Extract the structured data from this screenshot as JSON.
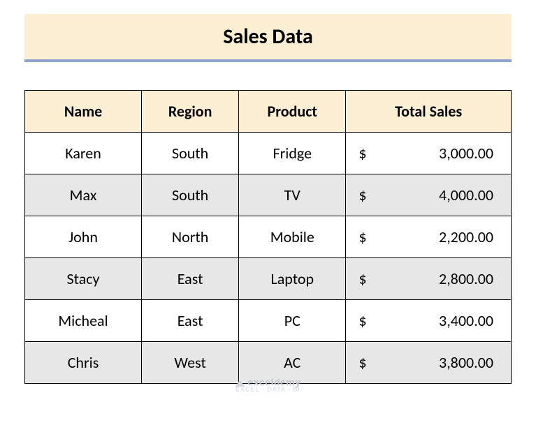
{
  "title": "Sales Data",
  "headers": {
    "name": "Name",
    "region": "Region",
    "product": "Product",
    "total_sales": "Total Sales"
  },
  "currency_symbol": "$",
  "rows": [
    {
      "name": "Karen",
      "region": "South",
      "product": "Fridge",
      "total_sales": "3,000.00"
    },
    {
      "name": "Max",
      "region": "South",
      "product": "TV",
      "total_sales": "4,000.00"
    },
    {
      "name": "John",
      "region": "North",
      "product": "Mobile",
      "total_sales": "2,200.00"
    },
    {
      "name": "Stacy",
      "region": "East",
      "product": "Laptop",
      "total_sales": "2,800.00"
    },
    {
      "name": "Micheal",
      "region": "East",
      "product": "PC",
      "total_sales": "3,400.00"
    },
    {
      "name": "Chris",
      "region": "West",
      "product": "AC",
      "total_sales": "3,800.00"
    }
  ],
  "watermark": {
    "brand": "exceldemy",
    "sub": "EXCEL · DATA · BI"
  },
  "chart_data": {
    "type": "table",
    "title": "Sales Data",
    "columns": [
      "Name",
      "Region",
      "Product",
      "Total Sales"
    ],
    "rows": [
      [
        "Karen",
        "South",
        "Fridge",
        3000.0
      ],
      [
        "Max",
        "South",
        "TV",
        4000.0
      ],
      [
        "John",
        "North",
        "Mobile",
        2200.0
      ],
      [
        "Stacy",
        "East",
        "Laptop",
        2800.0
      ],
      [
        "Micheal",
        "East",
        "PC",
        3400.0
      ],
      [
        "Chris",
        "West",
        "AC",
        3800.0
      ]
    ]
  }
}
